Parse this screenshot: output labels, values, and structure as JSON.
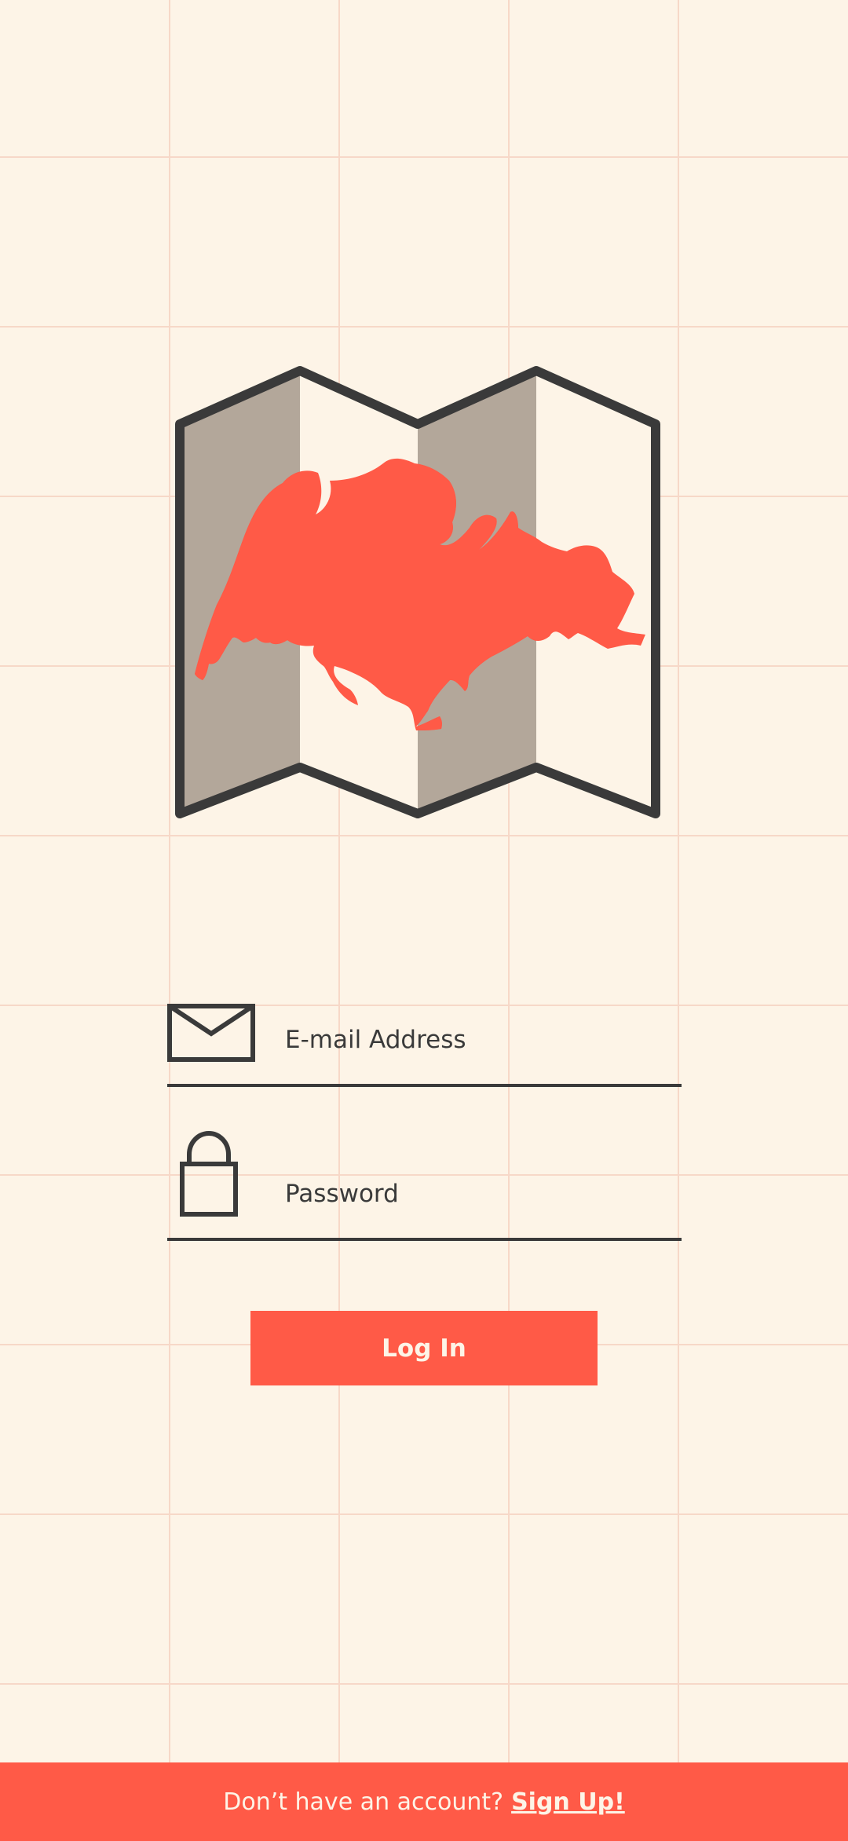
{
  "logo": {
    "icon": "folded-map-icon"
  },
  "login_form": {
    "email": {
      "placeholder": "E-mail Address",
      "icon": "envelope-icon"
    },
    "password": {
      "placeholder": "Password",
      "icon": "lock-icon"
    },
    "submit_label": "Log In"
  },
  "footer": {
    "prompt": "Don’t have an account?",
    "signup_link": "Sign Up!"
  },
  "colors": {
    "background": "#FDF4E7",
    "accent": "#FF5A47",
    "grid_line": "#F7D8C8",
    "ink": "#3A3A3A",
    "map_panel_shade": "#B3A79A",
    "map_island_dark": "#B13A34"
  }
}
